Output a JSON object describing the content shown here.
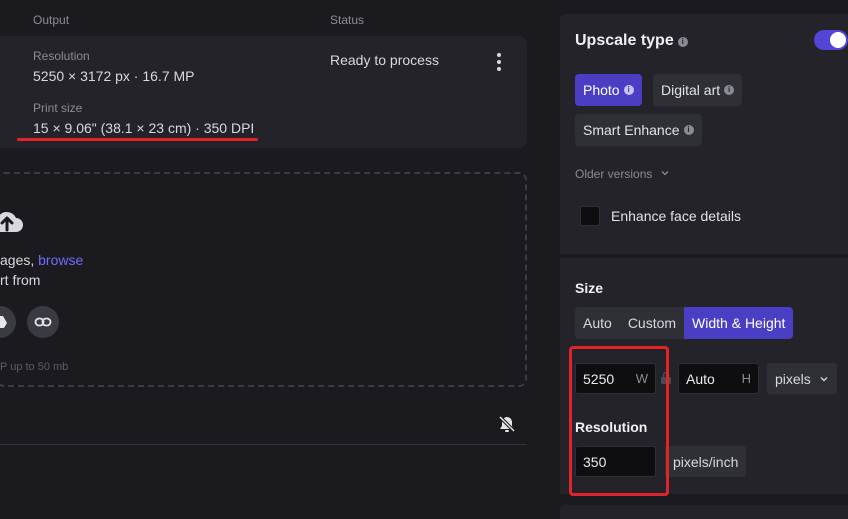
{
  "output": {
    "col_output": "Output",
    "col_status": "Status",
    "resolution_label": "Resolution",
    "resolution_value": "5250 × 3172 px · 16.7 MP",
    "print_label": "Print size",
    "print_value": "15 × 9.06\" (38.1 × 23 cm) · 350 DPI",
    "status_text": "Ready to process"
  },
  "dropzone": {
    "line1_prefix": "ages, ",
    "line1_link": "browse",
    "line2": "rt from",
    "hint": "P up to 50 mb"
  },
  "upscale": {
    "title": "Upscale type",
    "enabled": true,
    "types": [
      {
        "label": "Photo",
        "active": true
      },
      {
        "label": "Digital art",
        "active": false
      },
      {
        "label": "Smart Enhance",
        "active": false
      }
    ],
    "older_versions": "Older versions",
    "face_label": "Enhance face details",
    "face_checked": false
  },
  "size": {
    "title": "Size",
    "modes": [
      {
        "label": "Auto",
        "active": false
      },
      {
        "label": "Custom",
        "active": false
      },
      {
        "label": "Width & Height",
        "active": true
      }
    ],
    "width_value": "5250",
    "width_suffix": "W",
    "height_value": "Auto",
    "height_suffix": "H",
    "unit": "pixels",
    "resolution_title": "Resolution",
    "resolution_value": "350",
    "resolution_unit": "pixels/inch"
  },
  "colors": {
    "accent": "#4a3fc4",
    "highlight_red": "#e0242c",
    "link": "#6f6bff"
  }
}
